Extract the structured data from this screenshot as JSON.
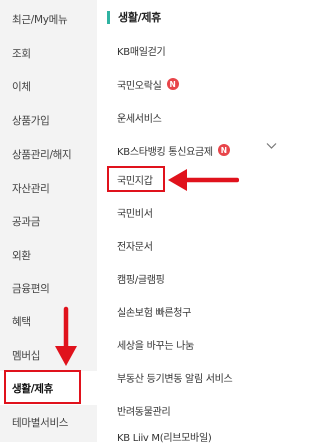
{
  "sidebar": {
    "items": [
      {
        "label": "최근/My메뉴"
      },
      {
        "label": "조회"
      },
      {
        "label": "이체"
      },
      {
        "label": "상품가입"
      },
      {
        "label": "상품관리/해지"
      },
      {
        "label": "자산관리"
      },
      {
        "label": "공과금"
      },
      {
        "label": "외환"
      },
      {
        "label": "금융편의"
      },
      {
        "label": "혜택"
      },
      {
        "label": "멤버십"
      },
      {
        "label": "생활/제휴"
      },
      {
        "label": "테마별서비스"
      }
    ],
    "active_label": "생활/제휴"
  },
  "panel": {
    "title": "생활/제휴",
    "items": [
      {
        "label": "KB매일걷기"
      },
      {
        "label": "국민오락실"
      },
      {
        "label": "운세서비스"
      },
      {
        "label": "KB스타뱅킹 통신요금제"
      },
      {
        "label": "국민지갑"
      },
      {
        "label": "국민비서"
      },
      {
        "label": "전자문서"
      },
      {
        "label": "캠핑/글램핑"
      },
      {
        "label": "실손보험 빠른청구"
      },
      {
        "label": "세상을 바꾸는 나눔"
      },
      {
        "label": "부동산 등기변동 알림 서비스"
      },
      {
        "label": "반려동물관리"
      },
      {
        "label": "KB Liiv M(리브모바일)"
      }
    ],
    "new_badge": "N"
  },
  "colors": {
    "sidebar_bg": "#f3f3f3",
    "accent_bar": "#2fb3a2",
    "badge": "#e8454a",
    "annotation_red": "#e0121c"
  },
  "icons": {
    "chevron": "chevron-down-icon",
    "arrow": "red-arrow-icon"
  }
}
